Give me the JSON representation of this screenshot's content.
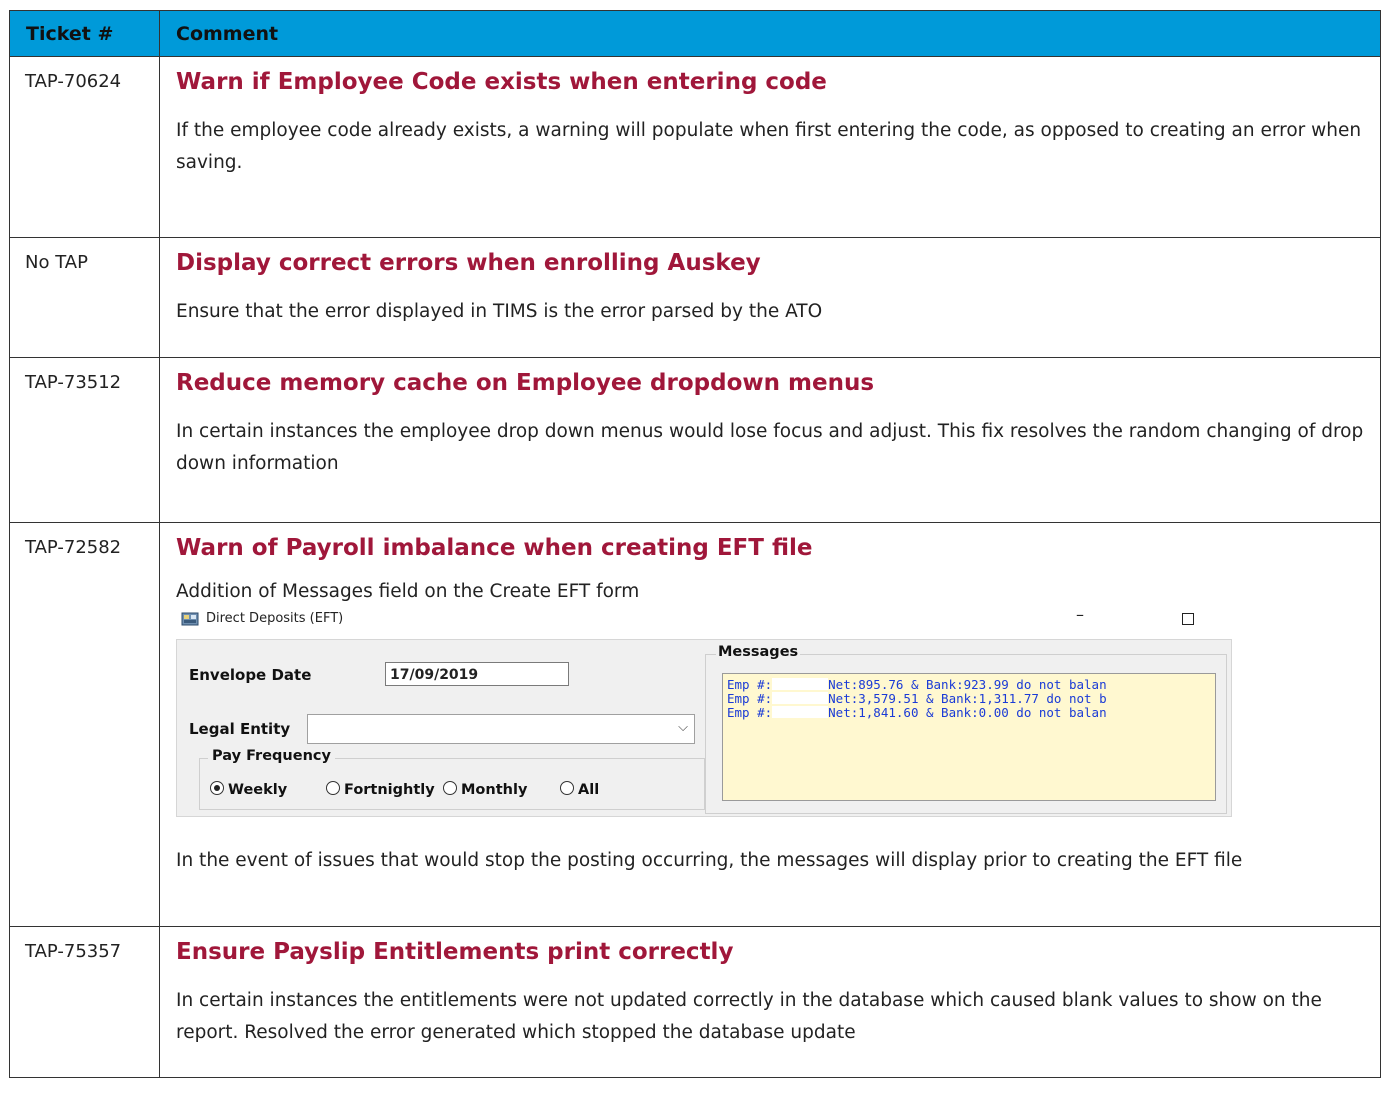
{
  "table": {
    "headers": {
      "ticket": "Ticket #",
      "comment": "Comment"
    },
    "rows": [
      {
        "ticket": "TAP-70624",
        "title": "Warn if Employee Code exists when entering code",
        "description": "If the employee code already exists, a warning will populate when first entering the code, as opposed to creating an error when saving."
      },
      {
        "ticket": "No TAP",
        "title": "Display correct errors when enrolling Auskey",
        "description": "Ensure that the error displayed in TIMS is the error parsed by the ATO"
      },
      {
        "ticket": "TAP-73512",
        "title": "Reduce memory cache on Employee dropdown menus",
        "description": "In certain instances the employee drop down menus would lose focus and adjust. This fix resolves the random changing of drop down information"
      },
      {
        "ticket": "TAP-72582",
        "title": "Warn of Payroll imbalance when creating EFT file",
        "intro": "Addition of Messages field on the Create EFT form",
        "description": "In the event of issues that would stop the posting occurring, the messages will display prior to creating the EFT file"
      },
      {
        "ticket": "TAP-75357",
        "title": "Ensure Payslip Entitlements print correctly",
        "description": "In certain instances the entitlements were not updated correctly in the database which caused blank values to show on the report. Resolved the error generated which stopped the database update"
      }
    ]
  },
  "dialog": {
    "window_title": "Direct Deposits (EFT)",
    "minimize_glyph": "–",
    "envelope_date_label": "Envelope Date",
    "envelope_date_value": "17/09/2019",
    "legal_entity_label": "Legal Entity",
    "pay_frequency_label": "Pay Frequency",
    "options": [
      "Weekly",
      "Fortnightly",
      "Monthly",
      "All"
    ],
    "selected_option": "Weekly",
    "messages_label": "Messages",
    "messages": [
      {
        "prefix": "Emp #:",
        "text": "Net:895.76 & Bank:923.99 do not balan"
      },
      {
        "prefix": "Emp #:",
        "text": "Net:3,579.51 & Bank:1,311.77 do not b"
      },
      {
        "prefix": "Emp #:",
        "text": "Net:1,841.60 & Bank:0.00 do not balan"
      }
    ],
    "colors": {
      "message_text": "#1b3bd6",
      "message_bg": "#fff8d0",
      "panel_bg": "#f0f0f0"
    }
  },
  "colors": {
    "header_bg": "#009ad9",
    "title_text": "#a0173a"
  }
}
